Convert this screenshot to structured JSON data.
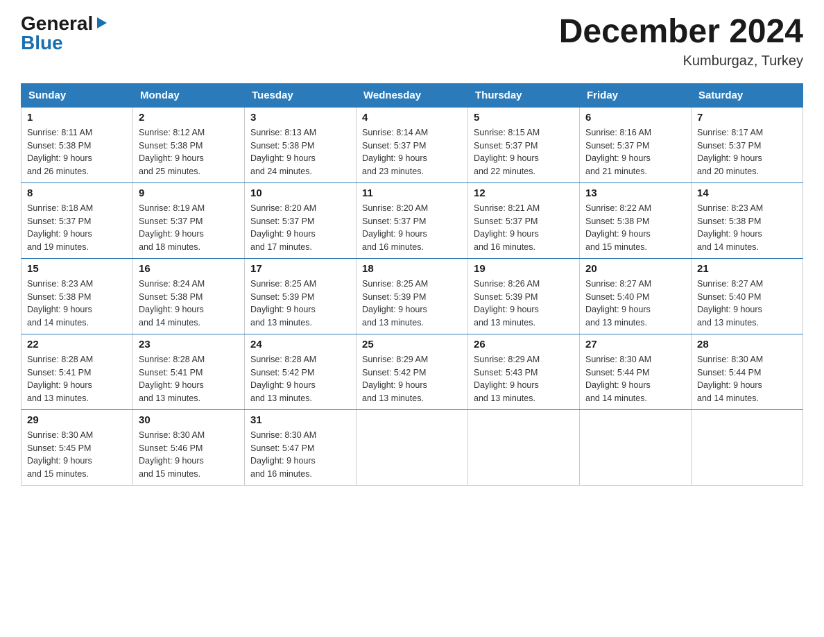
{
  "header": {
    "logo": {
      "general": "General",
      "blue": "Blue",
      "arrow": "▶"
    },
    "title": "December 2024",
    "location": "Kumburgaz, Turkey"
  },
  "calendar": {
    "weekdays": [
      "Sunday",
      "Monday",
      "Tuesday",
      "Wednesday",
      "Thursday",
      "Friday",
      "Saturday"
    ],
    "weeks": [
      [
        {
          "day": "1",
          "sunrise": "8:11 AM",
          "sunset": "5:38 PM",
          "daylight": "9 hours and 26 minutes."
        },
        {
          "day": "2",
          "sunrise": "8:12 AM",
          "sunset": "5:38 PM",
          "daylight": "9 hours and 25 minutes."
        },
        {
          "day": "3",
          "sunrise": "8:13 AM",
          "sunset": "5:38 PM",
          "daylight": "9 hours and 24 minutes."
        },
        {
          "day": "4",
          "sunrise": "8:14 AM",
          "sunset": "5:37 PM",
          "daylight": "9 hours and 23 minutes."
        },
        {
          "day": "5",
          "sunrise": "8:15 AM",
          "sunset": "5:37 PM",
          "daylight": "9 hours and 22 minutes."
        },
        {
          "day": "6",
          "sunrise": "8:16 AM",
          "sunset": "5:37 PM",
          "daylight": "9 hours and 21 minutes."
        },
        {
          "day": "7",
          "sunrise": "8:17 AM",
          "sunset": "5:37 PM",
          "daylight": "9 hours and 20 minutes."
        }
      ],
      [
        {
          "day": "8",
          "sunrise": "8:18 AM",
          "sunset": "5:37 PM",
          "daylight": "9 hours and 19 minutes."
        },
        {
          "day": "9",
          "sunrise": "8:19 AM",
          "sunset": "5:37 PM",
          "daylight": "9 hours and 18 minutes."
        },
        {
          "day": "10",
          "sunrise": "8:20 AM",
          "sunset": "5:37 PM",
          "daylight": "9 hours and 17 minutes."
        },
        {
          "day": "11",
          "sunrise": "8:20 AM",
          "sunset": "5:37 PM",
          "daylight": "9 hours and 16 minutes."
        },
        {
          "day": "12",
          "sunrise": "8:21 AM",
          "sunset": "5:37 PM",
          "daylight": "9 hours and 16 minutes."
        },
        {
          "day": "13",
          "sunrise": "8:22 AM",
          "sunset": "5:38 PM",
          "daylight": "9 hours and 15 minutes."
        },
        {
          "day": "14",
          "sunrise": "8:23 AM",
          "sunset": "5:38 PM",
          "daylight": "9 hours and 14 minutes."
        }
      ],
      [
        {
          "day": "15",
          "sunrise": "8:23 AM",
          "sunset": "5:38 PM",
          "daylight": "9 hours and 14 minutes."
        },
        {
          "day": "16",
          "sunrise": "8:24 AM",
          "sunset": "5:38 PM",
          "daylight": "9 hours and 14 minutes."
        },
        {
          "day": "17",
          "sunrise": "8:25 AM",
          "sunset": "5:39 PM",
          "daylight": "9 hours and 13 minutes."
        },
        {
          "day": "18",
          "sunrise": "8:25 AM",
          "sunset": "5:39 PM",
          "daylight": "9 hours and 13 minutes."
        },
        {
          "day": "19",
          "sunrise": "8:26 AM",
          "sunset": "5:39 PM",
          "daylight": "9 hours and 13 minutes."
        },
        {
          "day": "20",
          "sunrise": "8:27 AM",
          "sunset": "5:40 PM",
          "daylight": "9 hours and 13 minutes."
        },
        {
          "day": "21",
          "sunrise": "8:27 AM",
          "sunset": "5:40 PM",
          "daylight": "9 hours and 13 minutes."
        }
      ],
      [
        {
          "day": "22",
          "sunrise": "8:28 AM",
          "sunset": "5:41 PM",
          "daylight": "9 hours and 13 minutes."
        },
        {
          "day": "23",
          "sunrise": "8:28 AM",
          "sunset": "5:41 PM",
          "daylight": "9 hours and 13 minutes."
        },
        {
          "day": "24",
          "sunrise": "8:28 AM",
          "sunset": "5:42 PM",
          "daylight": "9 hours and 13 minutes."
        },
        {
          "day": "25",
          "sunrise": "8:29 AM",
          "sunset": "5:42 PM",
          "daylight": "9 hours and 13 minutes."
        },
        {
          "day": "26",
          "sunrise": "8:29 AM",
          "sunset": "5:43 PM",
          "daylight": "9 hours and 13 minutes."
        },
        {
          "day": "27",
          "sunrise": "8:30 AM",
          "sunset": "5:44 PM",
          "daylight": "9 hours and 14 minutes."
        },
        {
          "day": "28",
          "sunrise": "8:30 AM",
          "sunset": "5:44 PM",
          "daylight": "9 hours and 14 minutes."
        }
      ],
      [
        {
          "day": "29",
          "sunrise": "8:30 AM",
          "sunset": "5:45 PM",
          "daylight": "9 hours and 15 minutes."
        },
        {
          "day": "30",
          "sunrise": "8:30 AM",
          "sunset": "5:46 PM",
          "daylight": "9 hours and 15 minutes."
        },
        {
          "day": "31",
          "sunrise": "8:30 AM",
          "sunset": "5:47 PM",
          "daylight": "9 hours and 16 minutes."
        },
        null,
        null,
        null,
        null
      ]
    ]
  },
  "labels": {
    "sunrise": "Sunrise:",
    "sunset": "Sunset:",
    "daylight": "Daylight:"
  }
}
